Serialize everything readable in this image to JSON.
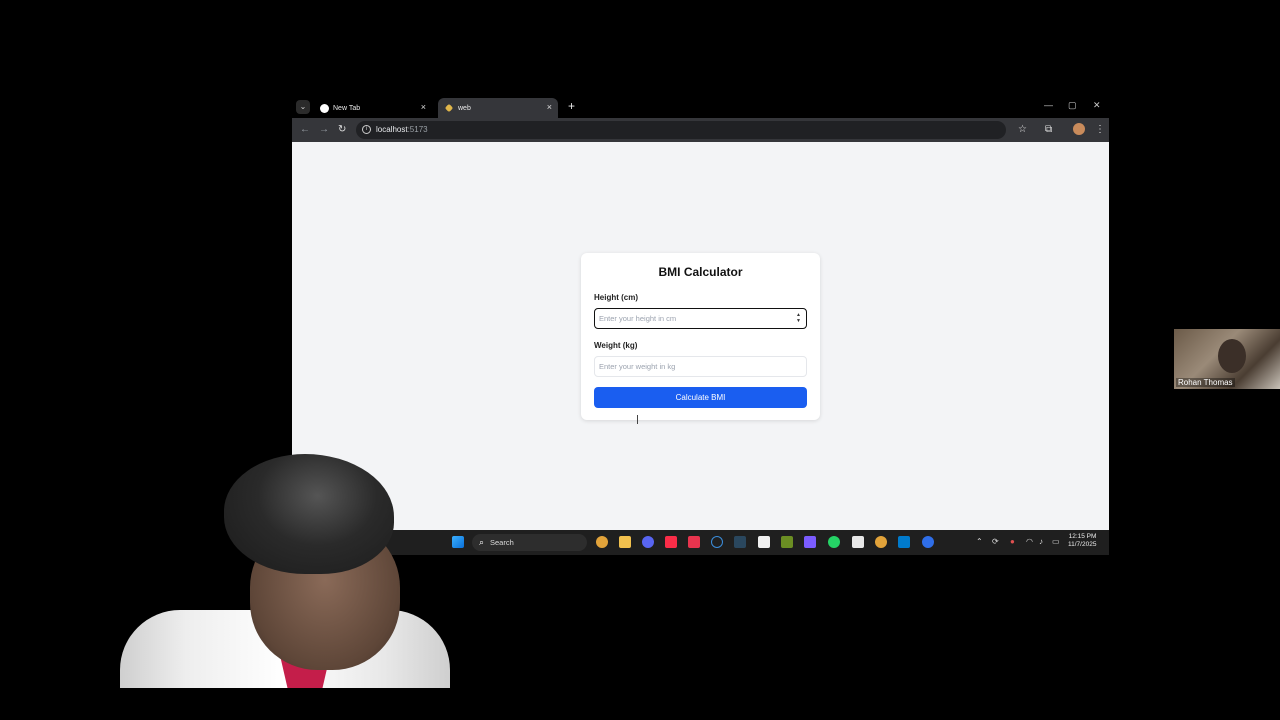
{
  "browser": {
    "tabs": [
      {
        "label": "New Tab",
        "active": false
      },
      {
        "label": "web",
        "active": true
      }
    ],
    "new_tab_symbol": "+",
    "close_symbol": "×",
    "window_controls": {
      "minimize": "—",
      "maximize": "▢",
      "close": "✕"
    },
    "address": {
      "host": "localhost",
      "port": ":5173"
    },
    "icons": [
      "back-icon",
      "forward-icon",
      "reload-icon",
      "site-info-icon",
      "bookmark-star-icon",
      "extensions-icon",
      "profile-avatar",
      "menu-kebab-icon"
    ]
  },
  "app": {
    "title": "BMI Calculator",
    "height_label": "Height (cm)",
    "height_placeholder": "Enter your height in cm",
    "weight_label": "Weight (kg)",
    "weight_placeholder": "Enter your weight in kg",
    "button_label": "Calculate BMI",
    "accent_color": "#1a5ef0"
  },
  "taskbar": {
    "search_label": "Search",
    "time": "12:15 PM",
    "date": "11/7/2025"
  },
  "webcam": {
    "participant_name": "Rohan Thomas"
  }
}
